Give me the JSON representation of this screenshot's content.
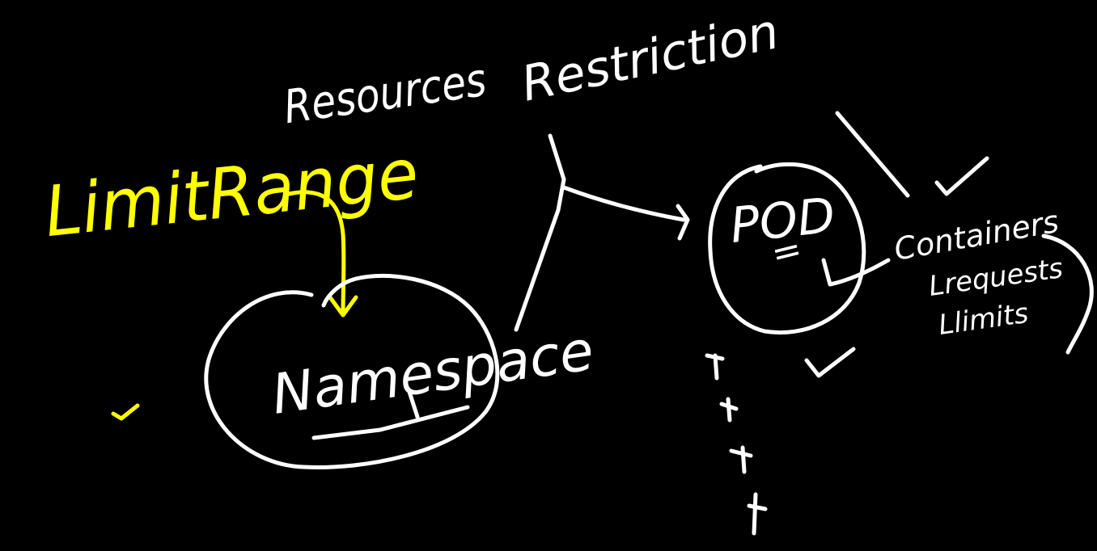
{
  "canvas": {
    "background": "#000000",
    "ink_colors": {
      "primary": "#ffffff",
      "highlight": "#ffff00"
    }
  },
  "labels": {
    "resources": "Resources",
    "restriction": "Restriction",
    "limit_range": "LimitRange",
    "namespace": "Namespace",
    "pod": "POD",
    "pod_eq": "=",
    "containers": "Containers",
    "requests": "Lrequests",
    "limits": "Llimits"
  },
  "marks": {
    "checkmark_count": 4,
    "cross_count": 4
  }
}
